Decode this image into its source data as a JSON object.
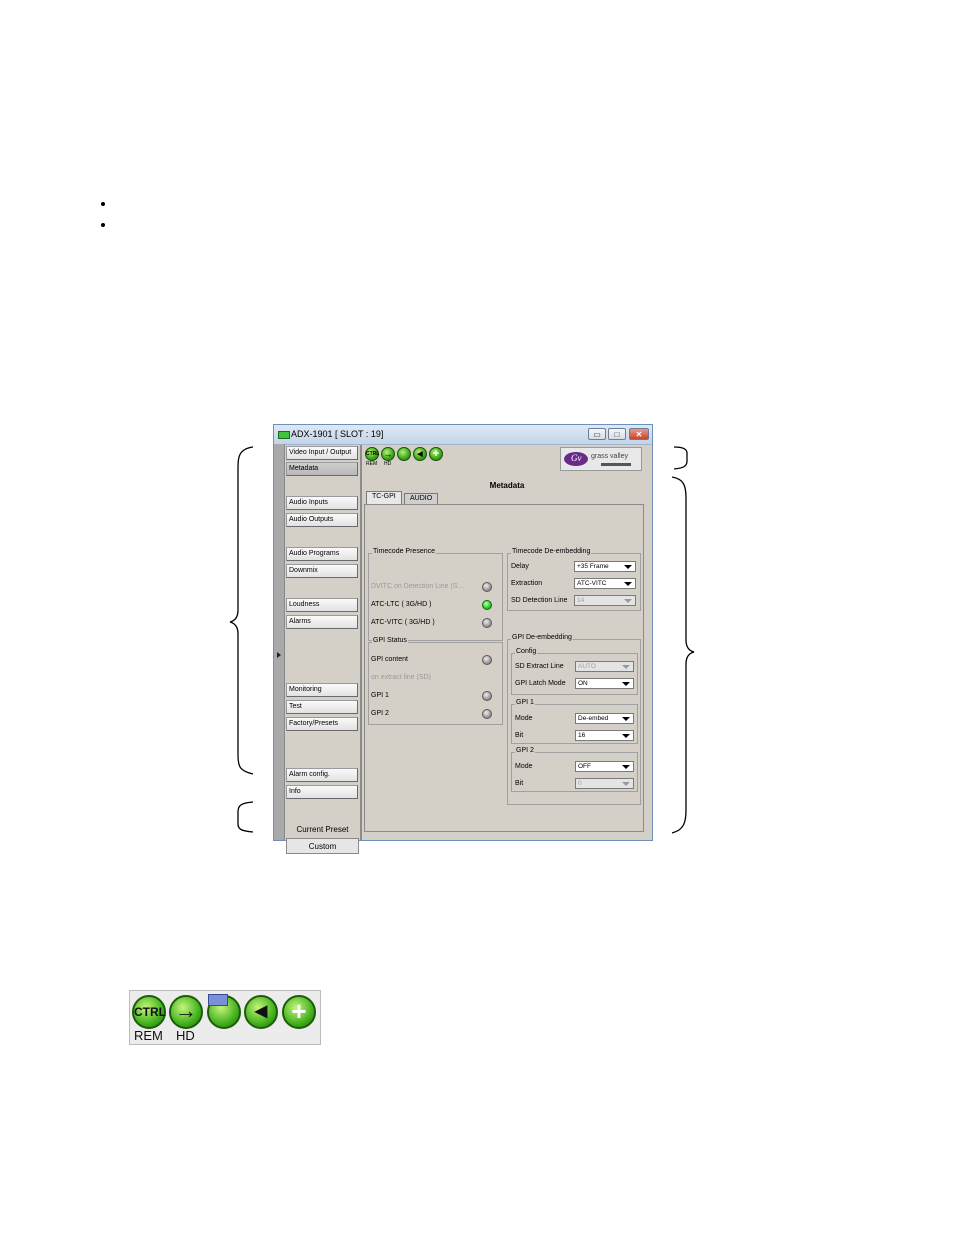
{
  "window": {
    "title": "ADX-1901 [ SLOT : 19]",
    "controls": {
      "minimize": "▭",
      "maximize": "□",
      "close": "✕"
    }
  },
  "toolbar": {
    "icons": [
      {
        "name": "ctrl-icon",
        "text": "CTRL",
        "label": "REM"
      },
      {
        "name": "arrow-right-icon",
        "text": "→",
        "label": "HD"
      },
      {
        "name": "reference-icon",
        "text": "",
        "label": ""
      },
      {
        "name": "speaker-icon",
        "text": "◀",
        "label": ""
      },
      {
        "name": "plus-icon",
        "text": "+",
        "label": ""
      }
    ],
    "logo": "grass valley"
  },
  "nav": {
    "items": [
      "Video Input / Output",
      "Metadata",
      "Audio Inputs",
      "Audio Outputs",
      "Audio Programs",
      "Downmix",
      "Loudness",
      "Alarms",
      "Monitoring",
      "Test",
      "Factory/Presets",
      "Alarm config.",
      "Info"
    ],
    "active": "Metadata",
    "preset_label": "Current Preset",
    "preset_value": "Custom"
  },
  "page": {
    "title": "Metadata",
    "tabs": [
      "TC-GPI",
      "AUDIO"
    ],
    "active_tab": "TC-GPI"
  },
  "timecode_presence": {
    "title": "Timecode Presence",
    "rows": [
      {
        "label": "DVITC on Detection Line (S...",
        "state": "off",
        "disabled": true
      },
      {
        "label": "ATC-LTC ( 3G/HD )",
        "state": "on",
        "disabled": false
      },
      {
        "label": "ATC-VITC ( 3G/HD )",
        "state": "off",
        "disabled": false
      }
    ]
  },
  "gpi_status": {
    "title": "GPI Status",
    "rows": [
      {
        "label": "GPI content",
        "led": true,
        "disabled": false
      },
      {
        "label": "on extract line (SD)",
        "led": false,
        "disabled": true
      },
      {
        "label": "GPI 1",
        "led": true,
        "disabled": false
      },
      {
        "label": "GPI 2",
        "led": true,
        "disabled": false
      }
    ]
  },
  "timecode_deembedding": {
    "title": "Timecode De-embedding",
    "delay_label": "Delay",
    "delay_value": "+35 Frame",
    "extraction_label": "Extraction",
    "extraction_value": "ATC-VITC",
    "sd_line_label": "SD Detection Line",
    "sd_line_value": "14"
  },
  "gpi_deembedding": {
    "title": "GPI De-embedding",
    "config": {
      "title": "Config",
      "sd_extract_label": "SD Extract Line",
      "sd_extract_value": "AUTO",
      "latch_label": "GPI Latch Mode",
      "latch_value": "ON"
    },
    "gpi1": {
      "title": "GPI 1",
      "mode_label": "Mode",
      "mode_value": "De-embed",
      "bit_label": "Bit",
      "bit_value": "16"
    },
    "gpi2": {
      "title": "GPI 2",
      "mode_label": "Mode",
      "mode_value": "OFF",
      "bit_label": "Bit",
      "bit_value": "0"
    }
  },
  "big_toolbar": {
    "icons": [
      {
        "name": "ctrl-icon",
        "text": "CTRL",
        "label": "REM"
      },
      {
        "name": "arrow-right-icon",
        "text": "→",
        "label": "HD"
      },
      {
        "name": "reference-icon",
        "text": "",
        "label": ""
      },
      {
        "name": "speaker-icon",
        "text": "◀",
        "label": ""
      },
      {
        "name": "plus-icon",
        "text": "+",
        "label": ""
      }
    ]
  }
}
